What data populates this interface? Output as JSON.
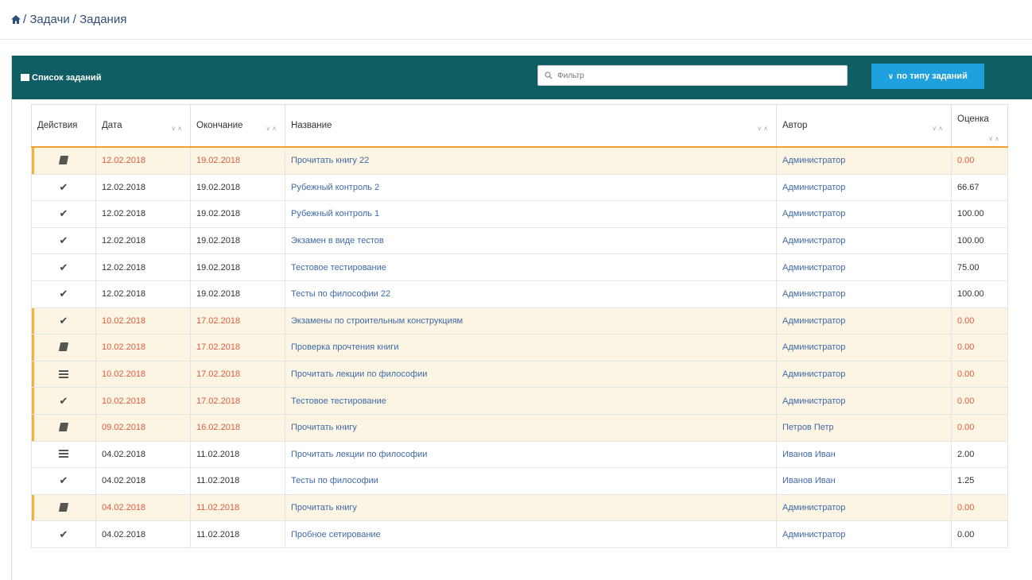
{
  "breadcrumb": {
    "items": [
      "Задачи",
      "Задания"
    ]
  },
  "panel": {
    "title": "Список заданий",
    "filter_placeholder": "Фильтр",
    "type_button": "по типу заданий"
  },
  "table": {
    "headers": {
      "actions": "Действия",
      "date": "Дата",
      "end": "Окончание",
      "name": "Название",
      "author": "Автор",
      "score": "Оценка"
    },
    "rows": [
      {
        "overdue": true,
        "action_icon": "book-icon",
        "date": "12.02.2018",
        "end": "19.02.2018",
        "name": "Прочитать книгу 22",
        "author": "Администратор",
        "score": "0.00"
      },
      {
        "overdue": false,
        "action_icon": "check-icon",
        "date": "12.02.2018",
        "end": "19.02.2018",
        "name": "Рубежный контроль 2",
        "author": "Администратор",
        "score": "66.67"
      },
      {
        "overdue": false,
        "action_icon": "check-icon",
        "date": "12.02.2018",
        "end": "19.02.2018",
        "name": "Рубежный контроль 1",
        "author": "Администратор",
        "score": "100.00"
      },
      {
        "overdue": false,
        "action_icon": "check-icon",
        "date": "12.02.2018",
        "end": "19.02.2018",
        "name": "Экзамен в виде тестов",
        "author": "Администратор",
        "score": "100.00"
      },
      {
        "overdue": false,
        "action_icon": "check-icon",
        "date": "12.02.2018",
        "end": "19.02.2018",
        "name": "Тестовое тестирование",
        "author": "Администратор",
        "score": "75.00"
      },
      {
        "overdue": false,
        "action_icon": "check-icon",
        "date": "12.02.2018",
        "end": "19.02.2018",
        "name": "Тесты по философии 22",
        "author": "Администратор",
        "score": "100.00"
      },
      {
        "overdue": true,
        "action_icon": "check-icon",
        "date": "10.02.2018",
        "end": "17.02.2018",
        "name": "Экзамены по строительным конструкциям",
        "author": "Администратор",
        "score": "0.00"
      },
      {
        "overdue": true,
        "action_icon": "book-icon",
        "date": "10.02.2018",
        "end": "17.02.2018",
        "name": "Проверка прочтения книги",
        "author": "Администратор",
        "score": "0.00"
      },
      {
        "overdue": true,
        "action_icon": "lines-icon",
        "date": "10.02.2018",
        "end": "17.02.2018",
        "name": "Прочитать лекции по философии",
        "author": "Администратор",
        "score": "0.00"
      },
      {
        "overdue": true,
        "action_icon": "check-icon",
        "date": "10.02.2018",
        "end": "17.02.2018",
        "name": "Тестовое тестирование",
        "author": "Администратор",
        "score": "0.00"
      },
      {
        "overdue": true,
        "action_icon": "book-icon",
        "date": "09.02.2018",
        "end": "16.02.2018",
        "name": "Прочитать книгу",
        "author": "Петров Петр",
        "score": "0.00"
      },
      {
        "overdue": false,
        "action_icon": "lines-icon",
        "date": "04.02.2018",
        "end": "11.02.2018",
        "name": "Прочитать лекции по философии",
        "author": "Иванов Иван",
        "score": "2.00"
      },
      {
        "overdue": false,
        "action_icon": "check-icon",
        "date": "04.02.2018",
        "end": "11.02.2018",
        "name": "Тесты по философии",
        "author": "Иванов Иван",
        "score": "1.25"
      },
      {
        "overdue": true,
        "action_icon": "book-icon",
        "date": "04.02.2018",
        "end": "11.02.2018",
        "name": "Прочитать книгу",
        "author": "Администратор",
        "score": "0.00"
      },
      {
        "overdue": false,
        "action_icon": "check-icon",
        "date": "04.02.2018",
        "end": "11.02.2018",
        "name": "Пробное сетирование",
        "author": "Администратор",
        "score": "0.00"
      }
    ]
  },
  "colors": {
    "header_bg": "#0f5e63",
    "button_bg": "#1ea1dd",
    "overdue_row_bg": "#fcf5e4",
    "overdue_text": "#e05a3d",
    "link_text": "#3f6aa8"
  }
}
